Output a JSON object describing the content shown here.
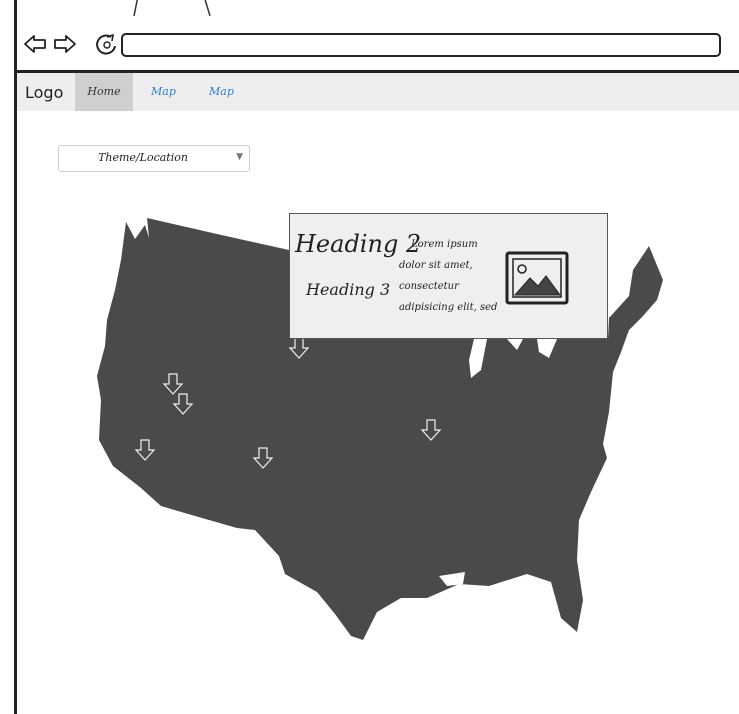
{
  "header": {
    "logo": "Logo",
    "menu": [
      {
        "label": "Home",
        "selected": true
      },
      {
        "label": "Map",
        "selected": false
      },
      {
        "label": "Map",
        "selected": false
      }
    ]
  },
  "filter": {
    "selected": "Theme/Location"
  },
  "popup": {
    "heading2": "Heading 2",
    "heading3": "Heading 3",
    "body": "Lorem ipsum dolor sit amet, consectetur adipisicing elit, sed do eiusmod"
  },
  "colors": {
    "map_fill": "#4a4a4a",
    "link": "#2a7fd4",
    "menubar": "#eeeeee"
  }
}
